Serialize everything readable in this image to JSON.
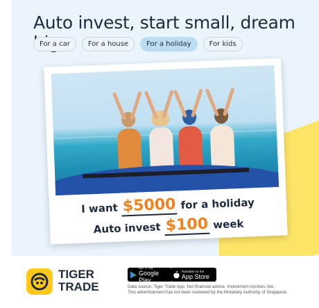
{
  "headline": "Auto invest, start small, dream big",
  "chips": [
    {
      "label": "For a car"
    },
    {
      "label": "For a house"
    },
    {
      "label": "For a holiday",
      "active": true
    },
    {
      "label": "For kids"
    }
  ],
  "caption": {
    "line1_pre": "I want",
    "line1_amount": "$5000",
    "line1_post": "for a holiday",
    "line2_pre": "Auto invest",
    "line2_amount": "$100",
    "line2_post": "week"
  },
  "brand": {
    "line1": "TIGER",
    "line2": "TRADE"
  },
  "badges": {
    "google_small": "GET IT ON",
    "google_big": "Google Play",
    "apple_small": "Available on the",
    "apple_big": "App Store"
  },
  "disclaimer": {
    "line1": "Data source: Tiger Trade App. Not financial advice. Investment involves risk.",
    "line2": "This advertisement has not been reviewed by the Monetary Authority of Singapore."
  },
  "colors": {
    "accent": "#f0821e",
    "logo_bg": "#ffc81a",
    "hero_bg": "#e9f4fb",
    "active_chip": "#bcdcf2"
  }
}
